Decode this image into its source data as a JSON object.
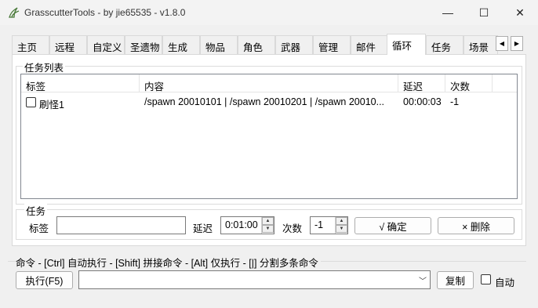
{
  "window": {
    "title": "GrasscutterTools  - by jie65535  - v1.8.0",
    "controls": {
      "minimize": "—",
      "maximize": "☐",
      "close": "✕"
    }
  },
  "tabs": [
    {
      "label": "主页"
    },
    {
      "label": "远程"
    },
    {
      "label": "自定义"
    },
    {
      "label": "圣遗物"
    },
    {
      "label": "生成"
    },
    {
      "label": "物品"
    },
    {
      "label": "角色"
    },
    {
      "label": "武器"
    },
    {
      "label": "管理"
    },
    {
      "label": "邮件"
    },
    {
      "label": "循环",
      "active": true
    },
    {
      "label": "任务"
    },
    {
      "label": "场景"
    }
  ],
  "task_list": {
    "title": "任务列表",
    "columns": [
      "标签",
      "内容",
      "延迟",
      "次数"
    ],
    "rows": [
      {
        "checked": false,
        "label": "刷怪1",
        "content": "/spawn 20010101 | /spawn 20010201 | /spawn 20010...",
        "delay": "00:00:03",
        "count": "-1"
      }
    ]
  },
  "task_form": {
    "title": "任务",
    "label_label": "标签",
    "label_value": "",
    "delay_label": "延迟",
    "delay_value": "0:01:00",
    "count_label": "次数",
    "count_value": "-1",
    "confirm_button": "√ 确定",
    "delete_button": "× 删除"
  },
  "command_bar": {
    "title": "命令  - [Ctrl] 自动执行  - [Shift] 拼接命令  - [Alt] 仅执行  - [|] 分割多条命令",
    "execute_button": "执行(F5)",
    "command_value": "",
    "copy_button": "复制",
    "auto_label": "自动",
    "auto_checked": false
  },
  "colors": {
    "accent": "#0078d4",
    "border": "#adadad",
    "background": "#f0f0f0"
  }
}
